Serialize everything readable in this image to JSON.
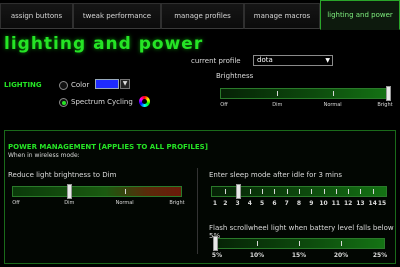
{
  "tabs": [
    {
      "label": "assign buttons",
      "active": false
    },
    {
      "label": "tweak performance",
      "active": false
    },
    {
      "label": "manage profiles",
      "active": false
    },
    {
      "label": "manage macros",
      "active": false
    },
    {
      "label": "lighting and power",
      "active": true
    }
  ],
  "page_title": "lighting and power",
  "profile": {
    "label": "current profile",
    "selected": "dota"
  },
  "lighting": {
    "section_label": "LIGHTING",
    "color_option": {
      "label": "Color",
      "selected": false,
      "swatch_color": "#1f2bff"
    },
    "spectrum_option": {
      "label": "Spectrum Cycling",
      "selected": true
    }
  },
  "brightness": {
    "label": "Brightness",
    "tick_labels": [
      "Off",
      "Dim",
      "Normal",
      "Bright"
    ],
    "value_fraction": 1.0
  },
  "power_management": {
    "title": "POWER MANAGEMENT [Applies to all profiles]",
    "subtitle": "When in wireless mode:",
    "reduce_brightness": {
      "label": "Reduce light brightness to Dim",
      "tick_labels": [
        "Off",
        "Dim",
        "Normal",
        "Bright"
      ],
      "value_fraction": 0.33
    },
    "sleep_mode": {
      "label": "Enter sleep mode after idle for 3 mins",
      "tick_labels": [
        "1",
        "2",
        "3",
        "4",
        "5",
        "6",
        "7",
        "8",
        "9",
        "10",
        "11",
        "12",
        "13",
        "14",
        "15"
      ],
      "value": 3
    },
    "scrollwheel_battery": {
      "label": "Flash scrollwheel light when battery level falls below 5%",
      "tick_labels": [
        "5%",
        "10%",
        "15%",
        "20%",
        "25%"
      ],
      "value_fraction": 0.0
    }
  },
  "colors": {
    "accent": "#25e425",
    "background": "#000000"
  }
}
